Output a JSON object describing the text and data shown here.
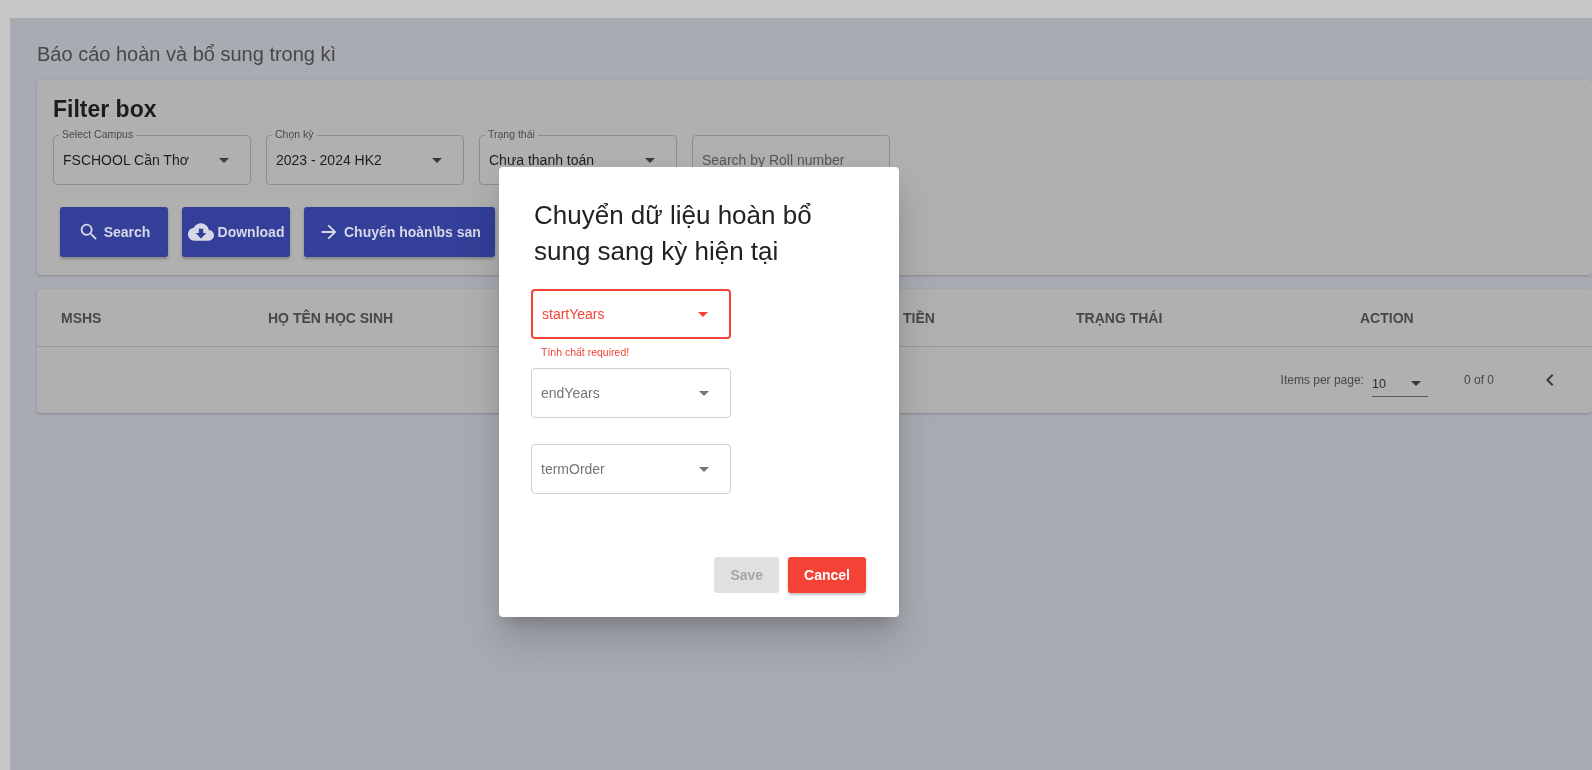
{
  "page_title": "Báo cáo hoàn và bổ sung trong kì",
  "filter": {
    "title": "Filter box",
    "fields": [
      {
        "kind": "select",
        "label": "Select Campus",
        "value": "FSCHOOL Cần Thơ"
      },
      {
        "kind": "select",
        "label": "Chọn kỳ",
        "value": "2023 - 2024 HK2"
      },
      {
        "kind": "select",
        "label": "Trạng thái",
        "value": "Chưa thanh toán"
      },
      {
        "kind": "search",
        "placeholder": "Search by Roll number"
      }
    ],
    "buttons": [
      {
        "label": "Search"
      },
      {
        "label": "Download"
      },
      {
        "label": "Chuyển hoàn\\bs san"
      }
    ]
  },
  "table": {
    "columns": [
      "MSHS",
      "HỌ TÊN HỌC SINH",
      "TIỀN",
      "TRẠNG THÁI",
      "ACTION"
    ]
  },
  "paginator": {
    "label": "Items per page:",
    "page_size": "10",
    "range": "0 of 0"
  },
  "dialog": {
    "title": "Chuyển dữ liệu hoàn bổ sung sang kỳ hiện tại",
    "fields": [
      {
        "placeholder": "startYears",
        "invalid": true,
        "error": "Tính chất required!"
      },
      {
        "placeholder": "endYears",
        "invalid": false
      },
      {
        "placeholder": "termOrder",
        "invalid": false
      }
    ],
    "buttons": [
      {
        "kind": "save",
        "label": "Save",
        "disabled": true
      },
      {
        "kind": "cancel",
        "label": "Cancel",
        "disabled": false
      }
    ]
  }
}
